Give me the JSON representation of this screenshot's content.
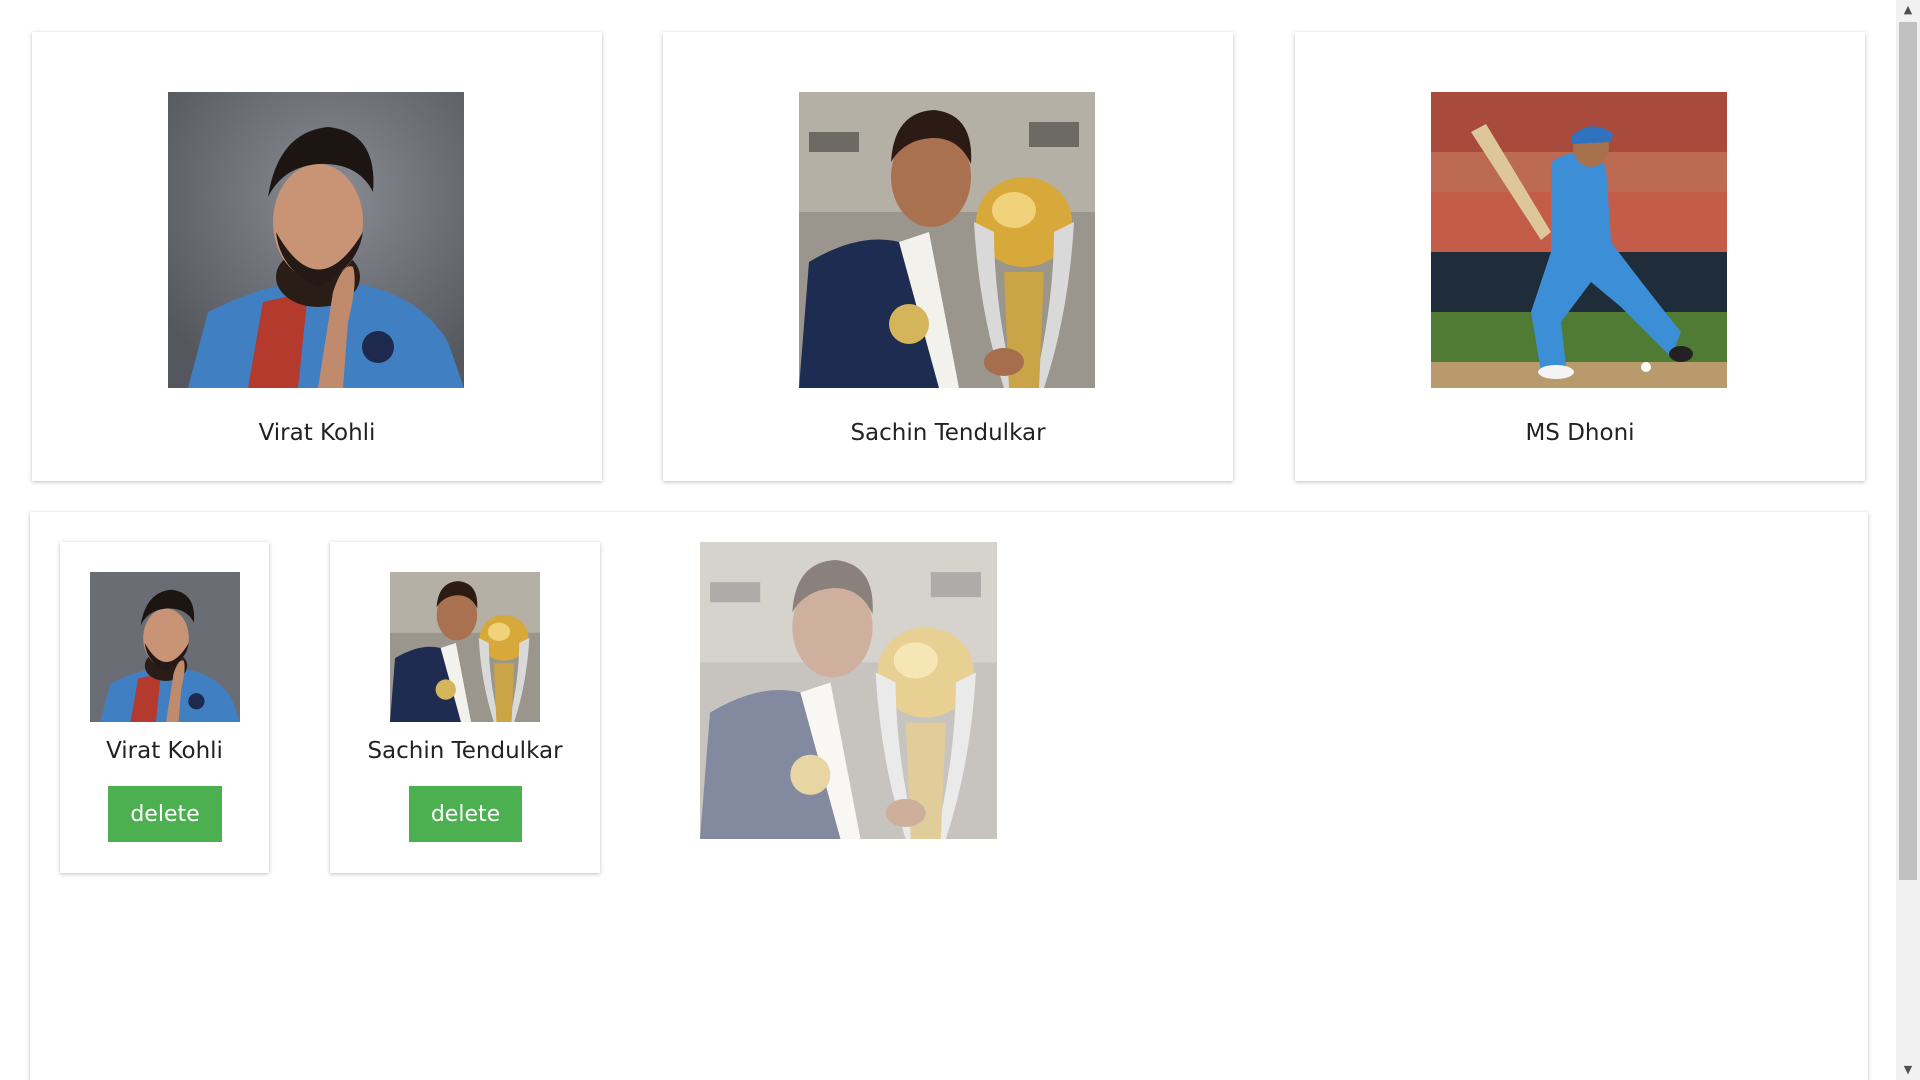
{
  "players": [
    {
      "name": "Virat Kohli",
      "photo_icon": "virat-kohli-photo"
    },
    {
      "name": "Sachin Tendulkar",
      "photo_icon": "sachin-tendulkar-photo"
    },
    {
      "name": "MS Dhoni",
      "photo_icon": "ms-dhoni-photo"
    }
  ],
  "selected": [
    {
      "name": "Virat Kohli",
      "delete_label": "delete"
    },
    {
      "name": "Sachin Tendulkar",
      "delete_label": "delete"
    }
  ],
  "colors": {
    "delete_button": "#4caf50",
    "card_shadow": "#bdbdbd",
    "scrollbar_thumb": "#c1c1c1"
  },
  "scrollbar": {
    "up_icon": "triangle-up-icon",
    "down_icon": "triangle-down-icon"
  }
}
